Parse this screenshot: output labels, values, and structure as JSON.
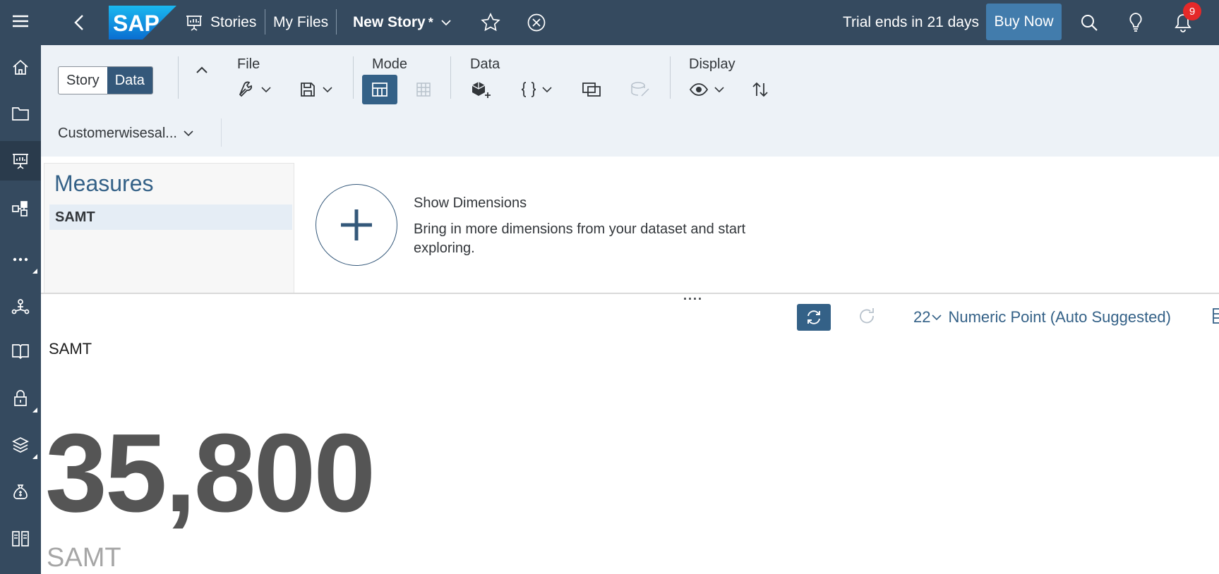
{
  "shell": {
    "brand": "SAP",
    "breadcrumb": [
      "Stories",
      "My Files"
    ],
    "story_title": "New Story",
    "story_dirty_marker": "*",
    "trial_text": "Trial ends in 21 days",
    "buy_label": "Buy Now",
    "notification_count": "9"
  },
  "nav_rail": {
    "items": [
      "menu-icon",
      "home-icon",
      "folder-icon",
      "stories-icon",
      "modeler-icon",
      "more-icon",
      "connections-icon",
      "catalog-icon",
      "security-icon",
      "deployment-icon",
      "planning-icon",
      "system-icon"
    ]
  },
  "toolbar": {
    "view_toggle": [
      "Story",
      "Data"
    ],
    "active_view": "Data",
    "groups": {
      "file": "File",
      "mode": "Mode",
      "data": "Data",
      "display": "Display"
    },
    "model_name": "Customerwisesal..."
  },
  "measures": {
    "title": "Measures",
    "items": [
      "SAMT"
    ]
  },
  "dimensions_prompt": {
    "title": "Show Dimensions",
    "description": "Bring in more dimensions from your dataset and start exploring."
  },
  "chart_toolbar": {
    "chart_type_glyph": "22",
    "chart_type_label": "Numeric Point (Auto Suggested)"
  },
  "kpi": {
    "header": "SAMT",
    "value": "35,800",
    "label": "SAMT"
  },
  "colors": {
    "shell_bg": "#354a5f",
    "accent": "#346187",
    "toolbar_bg": "#edf2f7",
    "badge": "#e52929"
  }
}
